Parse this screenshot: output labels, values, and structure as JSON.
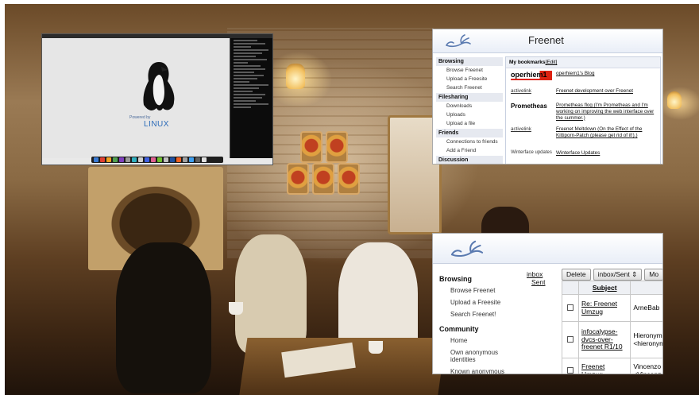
{
  "linux_window": {
    "powered_by": "Powered by",
    "brand": "LINUX"
  },
  "freenet_top": {
    "title": "Freenet",
    "nav": [
      {
        "type": "section",
        "label": "Browsing"
      },
      {
        "type": "item",
        "label": "Browse Freenet"
      },
      {
        "type": "item",
        "label": "Upload a Freesite"
      },
      {
        "type": "item",
        "label": "Search Freenet"
      },
      {
        "type": "section",
        "label": "Filesharing"
      },
      {
        "type": "item",
        "label": "Downloads"
      },
      {
        "type": "item",
        "label": "Uploads"
      },
      {
        "type": "item",
        "label": "Upload a file"
      },
      {
        "type": "section",
        "label": "Friends"
      },
      {
        "type": "item",
        "label": "Connections to friends"
      },
      {
        "type": "item",
        "label": "Add a Friend"
      },
      {
        "type": "section",
        "label": "Discussion"
      }
    ],
    "bookmarks_heading": "My bookmarks",
    "bookmarks_edit": "[Edit]",
    "bookmarks": [
      {
        "thumb": "operhiem1",
        "link": "operhiem1's Blog",
        "desc": ""
      },
      {
        "thumb": "activelink",
        "link": "Freenet development over Freenet",
        "desc": ""
      },
      {
        "thumb": "Prometheas",
        "link": "Prometheas flog",
        "desc": " (I'm Prometheas and I'm working on improving the web interface over the summer.)"
      },
      {
        "thumb": "activelink",
        "link": "Freenet Meltdown",
        "desc": " (On the Effect of the Kittiporn-Patch (please get rid of it!).)"
      },
      {
        "thumb": "Winterface updates",
        "link": "Winterface Updates",
        "desc": ""
      }
    ]
  },
  "freenet_bottom": {
    "nav": [
      {
        "type": "section",
        "label": "Browsing"
      },
      {
        "type": "item",
        "label": "Browse Freenet"
      },
      {
        "type": "item",
        "label": "Upload a Freesite"
      },
      {
        "type": "item",
        "label": "Search Freenet!"
      },
      {
        "type": "section",
        "label": "Community"
      },
      {
        "type": "item",
        "label": "Home"
      },
      {
        "type": "item",
        "label": "Own anonymous identities"
      },
      {
        "type": "item",
        "label": "Known anonymous identities"
      }
    ],
    "folders": [
      "inbox",
      "Sent"
    ],
    "toolbar": {
      "delete_label": "Delete",
      "folder_select": "inbox/Sent",
      "more_label": "Mo"
    },
    "table": {
      "subject_header": "Subject",
      "rows": [
        {
          "subject": "Re: Freenet Umzug",
          "from": "ArneBab"
        },
        {
          "subject": "infocalypse-dvcs-over-freenet R1/10",
          "from": "Hieronym <hieronym"
        },
        {
          "subject": "Freenet Umzug",
          "from": "Vincenzo <Vincenzo"
        }
      ]
    }
  },
  "colors": {
    "freenet_header": "#e9eef7",
    "linux_blue": "#2a6ab8",
    "oper_red": "#dd2211"
  }
}
